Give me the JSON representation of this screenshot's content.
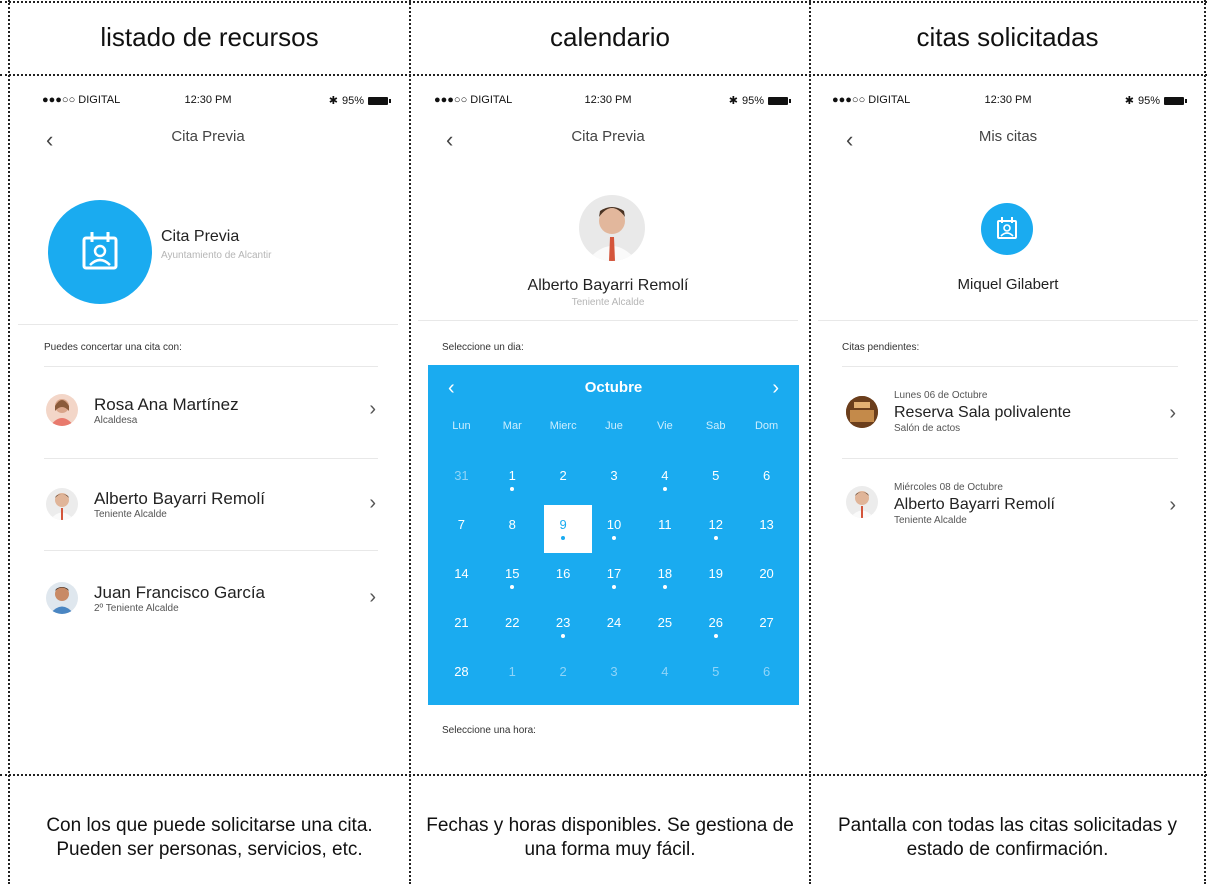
{
  "columns": [
    {
      "title": "listado de recursos",
      "caption": "Con los que puede solicitarse una cita. Pueden ser personas, servicios, etc."
    },
    {
      "title": "calendario",
      "caption": "Fechas y horas disponibles. Se gestiona de una forma muy fácil."
    },
    {
      "title": "citas solicitadas",
      "caption": "Pantalla con todas las citas solicitadas y estado de confirmación."
    }
  ],
  "status": {
    "carrier": "●●●○○ DIGITAL",
    "time": "12:30 PM",
    "battery": "95%"
  },
  "screen1": {
    "nav_title": "Cita Previa",
    "header_title": "Cita Previa",
    "header_subtitle": "Ayuntamiento de Alcantir",
    "section_label": "Puedes concertar una cita con:",
    "items": [
      {
        "name": "Rosa Ana Martínez",
        "role": "Alcaldesa"
      },
      {
        "name": "Alberto Bayarri Remolí",
        "role": "Teniente Alcalde"
      },
      {
        "name": "Juan Francisco García",
        "role": "2º Teniente Alcalde"
      }
    ]
  },
  "screen2": {
    "nav_title": "Cita Previa",
    "person_name": "Alberto Bayarri Remolí",
    "person_role": "Teniente Alcalde",
    "day_label": "Seleccione un dia:",
    "hour_label": "Seleccione una hora:",
    "month": "Octubre",
    "weekdays": [
      "Lun",
      "Mar",
      "Mierc",
      "Jue",
      "Vie",
      "Sab",
      "Dom"
    ],
    "days": [
      {
        "n": "31",
        "muted": true,
        "dot": false
      },
      {
        "n": "1",
        "muted": false,
        "dot": true
      },
      {
        "n": "2",
        "muted": false,
        "dot": false
      },
      {
        "n": "3",
        "muted": false,
        "dot": false
      },
      {
        "n": "4",
        "muted": false,
        "dot": true
      },
      {
        "n": "5",
        "muted": false,
        "dot": false
      },
      {
        "n": "6",
        "muted": false,
        "dot": false
      },
      {
        "n": "7",
        "muted": false,
        "dot": false
      },
      {
        "n": "8",
        "muted": false,
        "dot": false
      },
      {
        "n": "9",
        "muted": false,
        "dot": true,
        "selected": true
      },
      {
        "n": "10",
        "muted": false,
        "dot": true
      },
      {
        "n": "11",
        "muted": false,
        "dot": false
      },
      {
        "n": "12",
        "muted": false,
        "dot": true
      },
      {
        "n": "13",
        "muted": false,
        "dot": false
      },
      {
        "n": "14",
        "muted": false,
        "dot": false
      },
      {
        "n": "15",
        "muted": false,
        "dot": true
      },
      {
        "n": "16",
        "muted": false,
        "dot": false
      },
      {
        "n": "17",
        "muted": false,
        "dot": true
      },
      {
        "n": "18",
        "muted": false,
        "dot": true
      },
      {
        "n": "19",
        "muted": false,
        "dot": false
      },
      {
        "n": "20",
        "muted": false,
        "dot": false
      },
      {
        "n": "21",
        "muted": false,
        "dot": false
      },
      {
        "n": "22",
        "muted": false,
        "dot": false
      },
      {
        "n": "23",
        "muted": false,
        "dot": true
      },
      {
        "n": "24",
        "muted": false,
        "dot": false
      },
      {
        "n": "25",
        "muted": false,
        "dot": false
      },
      {
        "n": "26",
        "muted": false,
        "dot": true
      },
      {
        "n": "27",
        "muted": false,
        "dot": false
      },
      {
        "n": "28",
        "muted": false,
        "dot": false
      },
      {
        "n": "1",
        "muted": true,
        "dot": false
      },
      {
        "n": "2",
        "muted": true,
        "dot": false
      },
      {
        "n": "3",
        "muted": true,
        "dot": false
      },
      {
        "n": "4",
        "muted": true,
        "dot": false
      },
      {
        "n": "5",
        "muted": true,
        "dot": false
      },
      {
        "n": "6",
        "muted": true,
        "dot": false
      }
    ]
  },
  "screen3": {
    "nav_title": "Mis citas",
    "user_name": "Miquel Gilabert",
    "section_label": "Citas pendientes:",
    "items": [
      {
        "date": "Lunes 06 de Octubre",
        "title": "Reserva Sala polivalente",
        "subtitle": "Salón de actos"
      },
      {
        "date": "Miércoles 08 de Octubre",
        "title": "Alberto Bayarri Remolí",
        "subtitle": "Teniente Alcalde"
      }
    ]
  },
  "colors": {
    "accent": "#1aabf0"
  }
}
